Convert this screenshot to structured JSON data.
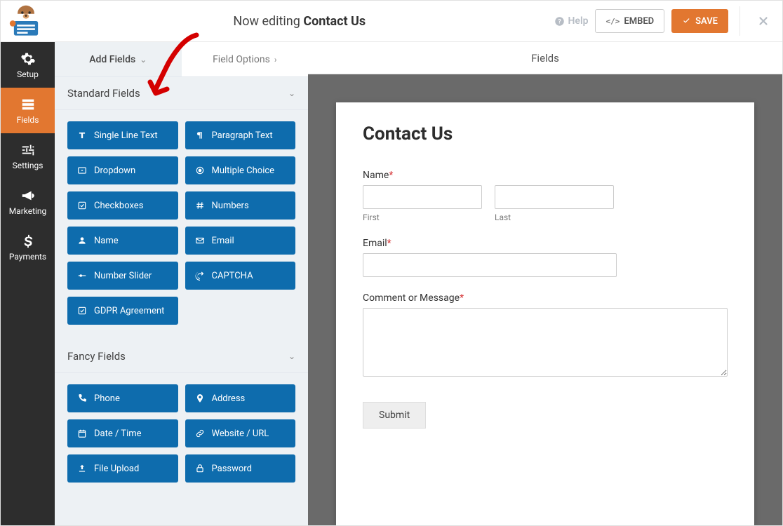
{
  "header": {
    "now_editing": "Now editing",
    "form_name": "Contact Us",
    "help": "Help",
    "embed": "EMBED",
    "save": "SAVE"
  },
  "leftnav": {
    "setup": "Setup",
    "fields": "Fields",
    "settings": "Settings",
    "marketing": "Marketing",
    "payments": "Payments"
  },
  "panel": {
    "tab_add": "Add Fields",
    "tab_options": "Field Options",
    "section_standard": "Standard Fields",
    "section_fancy": "Fancy Fields",
    "standard": [
      "Single Line Text",
      "Paragraph Text",
      "Dropdown",
      "Multiple Choice",
      "Checkboxes",
      "Numbers",
      "Name",
      "Email",
      "Number Slider",
      "CAPTCHA",
      "GDPR Agreement"
    ],
    "fancy": [
      "Phone",
      "Address",
      "Date / Time",
      "Website / URL",
      "File Upload",
      "Password"
    ]
  },
  "right": {
    "header": "Fields"
  },
  "form": {
    "title": "Contact Us",
    "name_label": "Name",
    "first": "First",
    "last": "Last",
    "email_label": "Email",
    "message_label": "Comment or Message",
    "submit": "Submit"
  }
}
